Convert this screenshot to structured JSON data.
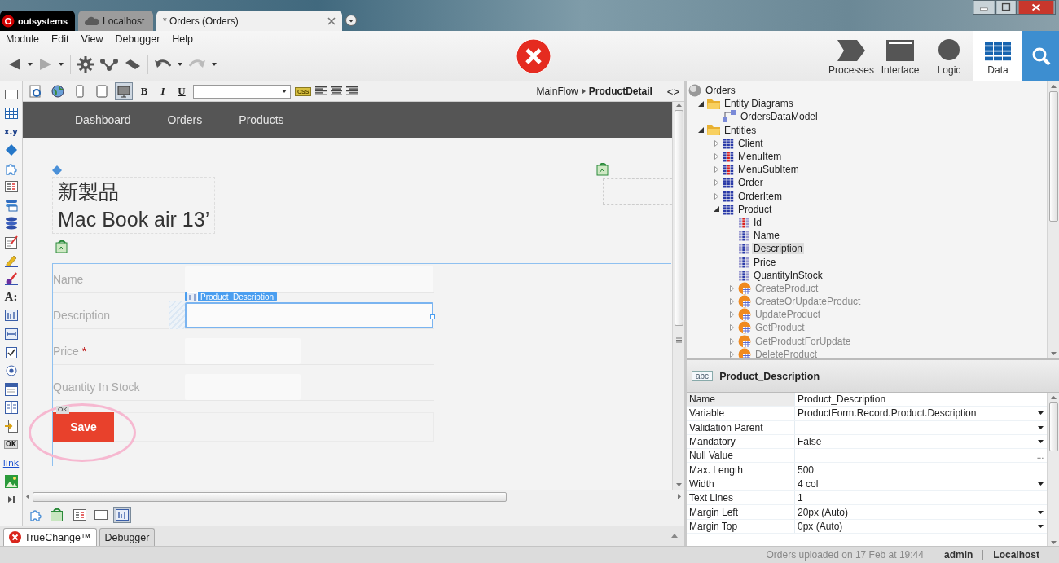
{
  "window": {
    "tabs": [
      {
        "label": "outsystems",
        "kind": "logo",
        "selected": false
      },
      {
        "label": "Localhost",
        "kind": "server",
        "selected": false
      },
      {
        "label": "* Orders (Orders)",
        "kind": "module",
        "selected": true
      }
    ]
  },
  "menu": [
    "Module",
    "Edit",
    "View",
    "Debugger",
    "Help"
  ],
  "app_tabs": [
    {
      "label": "Processes",
      "kind": "processes",
      "selected": false
    },
    {
      "label": "Interface",
      "kind": "interface",
      "selected": false
    },
    {
      "label": "Logic",
      "kind": "logic",
      "selected": false
    },
    {
      "label": "Data",
      "kind": "data",
      "selected": true
    }
  ],
  "palette": [
    {
      "kind": "container"
    },
    {
      "kind": "table"
    },
    {
      "kind": "text",
      "label": "x.y"
    },
    {
      "kind": "diamond"
    },
    {
      "kind": "puzzle"
    },
    {
      "kind": "list"
    },
    {
      "kind": "records"
    },
    {
      "kind": "stack"
    },
    {
      "kind": "form"
    },
    {
      "kind": "pencil"
    },
    {
      "kind": "brush"
    },
    {
      "kind": "text",
      "label": "A:"
    },
    {
      "kind": "input"
    },
    {
      "kind": "range"
    },
    {
      "kind": "checkbox"
    },
    {
      "kind": "radio"
    },
    {
      "kind": "calendar"
    },
    {
      "kind": "columns"
    },
    {
      "kind": "import"
    },
    {
      "kind": "text",
      "label": "OK"
    },
    {
      "kind": "link",
      "label": "link"
    },
    {
      "kind": "image"
    },
    {
      "kind": "more"
    }
  ],
  "editor_toolbar": {
    "devices": [
      {
        "kind": "preview",
        "selected": false
      },
      {
        "kind": "web",
        "selected": false
      },
      {
        "kind": "phone",
        "selected": false
      },
      {
        "kind": "tablet",
        "selected": false
      },
      {
        "kind": "desktop",
        "selected": true
      }
    ],
    "format": [
      "B",
      "I",
      "U"
    ],
    "css": "CSS",
    "breadcrumb": [
      "MainFlow",
      "ProductDetail"
    ],
    "code_toggle": "<>"
  },
  "canvas": {
    "nav": [
      "Dashboard",
      "Orders",
      "Products"
    ],
    "title_lines": [
      "新製品",
      "Mac Book air 13’"
    ],
    "widget_tag": "Product_Description",
    "form": [
      {
        "label": "Name",
        "kind": "wide",
        "selected": false
      },
      {
        "label": "Description",
        "kind": "wide",
        "selected": true
      },
      {
        "label": "Price",
        "kind": "narrow",
        "selected": false,
        "required_mark": "*"
      },
      {
        "label": "Quantity In Stock",
        "kind": "narrow",
        "selected": false
      }
    ],
    "button_badge": "OK",
    "save_button": "Save"
  },
  "widget_tabs": [
    {
      "kind": "puzzle",
      "selected": false
    },
    {
      "kind": "screen",
      "selected": false
    },
    {
      "kind": "list",
      "selected": false
    },
    {
      "kind": "container",
      "selected": false
    },
    {
      "kind": "input",
      "selected": true
    }
  ],
  "bottom_tabs": [
    {
      "label": "TrueChange™",
      "kind": "errors",
      "selected": true
    },
    {
      "label": "Debugger",
      "kind": "plain",
      "selected": false
    }
  ],
  "tree": {
    "label": "Orders",
    "kind": "module",
    "selected": false,
    "children": [
      {
        "label": "Entity Diagrams",
        "kind": "folder",
        "expanded": true,
        "selected": false,
        "children": [
          {
            "label": "OrdersDataModel",
            "kind": "diagram",
            "selected": false
          }
        ]
      },
      {
        "label": "Entities",
        "kind": "folder",
        "expanded": true,
        "selected": false,
        "children": [
          {
            "label": "Client",
            "kind": "entity",
            "expanded": false,
            "selected": false
          },
          {
            "label": "MenuItem",
            "kind": "static",
            "expanded": false,
            "selected": false
          },
          {
            "label": "MenuSubItem",
            "kind": "static",
            "expanded": false,
            "selected": false
          },
          {
            "label": "Order",
            "kind": "entity",
            "expanded": false,
            "selected": false
          },
          {
            "label": "OrderItem",
            "kind": "entity",
            "expanded": false,
            "selected": false
          },
          {
            "label": "Product",
            "kind": "entity",
            "expanded": true,
            "selected": false,
            "children": [
              {
                "label": "Id",
                "kind": "key",
                "selected": false
              },
              {
                "label": "Name",
                "kind": "attribute",
                "selected": false
              },
              {
                "label": "Description",
                "kind": "attribute",
                "selected": true
              },
              {
                "label": "Price",
                "kind": "attribute",
                "selected": false
              },
              {
                "label": "QuantityInStock",
                "kind": "attribute",
                "selected": false
              },
              {
                "label": "CreateProduct",
                "kind": "action",
                "expanded": false,
                "selected": false
              },
              {
                "label": "CreateOrUpdateProduct",
                "kind": "action",
                "expanded": false,
                "selected": false
              },
              {
                "label": "UpdateProduct",
                "kind": "action",
                "expanded": false,
                "selected": false
              },
              {
                "label": "GetProduct",
                "kind": "action",
                "expanded": false,
                "selected": false
              },
              {
                "label": "GetProductForUpdate",
                "kind": "action",
                "expanded": false,
                "selected": false
              },
              {
                "label": "DeleteProduct",
                "kind": "action",
                "expanded": false,
                "selected": false
              }
            ]
          }
        ]
      }
    ]
  },
  "properties": {
    "type_badge": "abc",
    "title": "Product_Description",
    "rows": [
      {
        "name": "Name",
        "value": "Product_Description",
        "selected": true,
        "dropdown": false
      },
      {
        "name": "Variable",
        "value": "ProductForm.Record.Product.Description",
        "selected": false,
        "dropdown": true
      },
      {
        "name": "Validation Parent",
        "selected": false,
        "dropdown": true
      },
      {
        "name": "Mandatory",
        "value": "False",
        "selected": false,
        "dropdown": true
      },
      {
        "name": "Null Value",
        "selected": false,
        "dropdown": false,
        "button": "..."
      },
      {
        "name": "Max. Length",
        "value": "500",
        "selected": false,
        "dropdown": false
      },
      {
        "name": "Width",
        "value": "4 col",
        "selected": false,
        "dropdown": true
      },
      {
        "name": "Text Lines",
        "value": "1",
        "selected": false,
        "dropdown": false
      },
      {
        "name": "Margin Left",
        "value": "20px (Auto)",
        "selected": false,
        "dropdown": true
      },
      {
        "name": "Margin Top",
        "value": "0px (Auto)",
        "selected": false,
        "dropdown": true
      }
    ]
  },
  "status_bar": {
    "message": "Orders uploaded on 17 Feb at 19:44",
    "user": "admin",
    "server": "Localhost"
  }
}
